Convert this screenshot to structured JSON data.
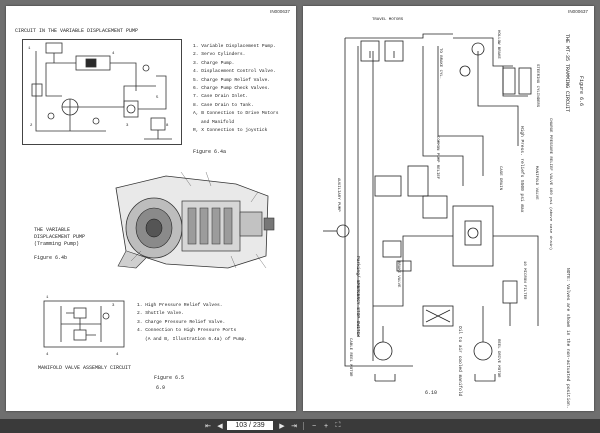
{
  "doc_code": "IN000637",
  "left_page": {
    "doc_code": "IN000637",
    "section1": {
      "heading": "CIRCUIT IN THE VARIABLE DISPLACEMENT PUMP",
      "legend": [
        "1. Variable Displacement Pump.",
        "2. Servo Cylinders.",
        "3. Charge Pump.",
        "4. Displacement Control Valve.",
        "5. Charge Pump Relief Valve.",
        "6. Charge Pump Check Valves.",
        "7. Case Drain Inlet.",
        "8. Case Drain to Tank.",
        "A, B Connection to Drive Motors",
        "and Manifold",
        "R, X Connection to joystick"
      ],
      "figure": "Figure 6.4a"
    },
    "section2": {
      "caption_line1": "THE VARIABLE",
      "caption_line2": "DISPLACEMENT PUMP",
      "caption_line3": "(Tramming Pump)",
      "figure": "Figure 6.4b"
    },
    "section3": {
      "legend": [
        "1. High Pressure Relief Valves.",
        "2. Shuttle Valve.",
        "3. Charge Pressure Relief Valve.",
        "4. Connection to High Pressure Ports",
        "(A and B, Illustration 6.4a) of Pump."
      ],
      "heading": "MANIFOLD VALVE ASSEMBLY CIRCUIT",
      "figure": "Figure 6.5",
      "page_number": "6.9"
    }
  },
  "right_page": {
    "doc_code": "IN000637",
    "labels": {
      "travel_motors": "TRAVEL MOTORS",
      "to_brake_cyl": "TO BRAKE CYL.",
      "hollow_brake": "HOLLOW BRAKE",
      "steering_cylinders": "STEERING CYLINDERS",
      "tramming_circuit_title": "THE MT-35 TRAMMING CIRCUIT",
      "figure": "Figure 6.6",
      "high_press": "High Press. reliefs 5500 psi max",
      "charge_press": "CHARGE PRESSURE RELIEF VALVE 160 psi (above case drain)",
      "common_pump": "COMMON PUMP RELIEF",
      "case_drain": "CASE DRAIN",
      "manifold_valve": "MANIFOLD VALVE",
      "auxiliary_pump": "AUXILIARY PUMP",
      "parking_brake": "Parking/ EMERGENCY STOP SWITCH",
      "brake_valve": "BRAKE VALVE",
      "hp_filter": "10 MICRON FILTER",
      "oil_cooler": "Oil to air cooled manifold",
      "cable_reel": "CABLE REEL MOTOR",
      "reel_drive": "REEL DRIVE MOTOR",
      "note": "NOTE: Valves are shown in the non-actuated position.",
      "page_number": "6.10"
    }
  },
  "toolbar": {
    "first_icon": "first-page-icon",
    "prev_icon": "previous-page-icon",
    "current_page": "103",
    "separator": "/",
    "total_pages": "239",
    "next_icon": "next-page-icon",
    "last_icon": "last-page-icon",
    "zoom_out_icon": "zoom-out-icon",
    "zoom_in_icon": "zoom-in-icon",
    "fullscreen_icon": "fullscreen-icon"
  }
}
